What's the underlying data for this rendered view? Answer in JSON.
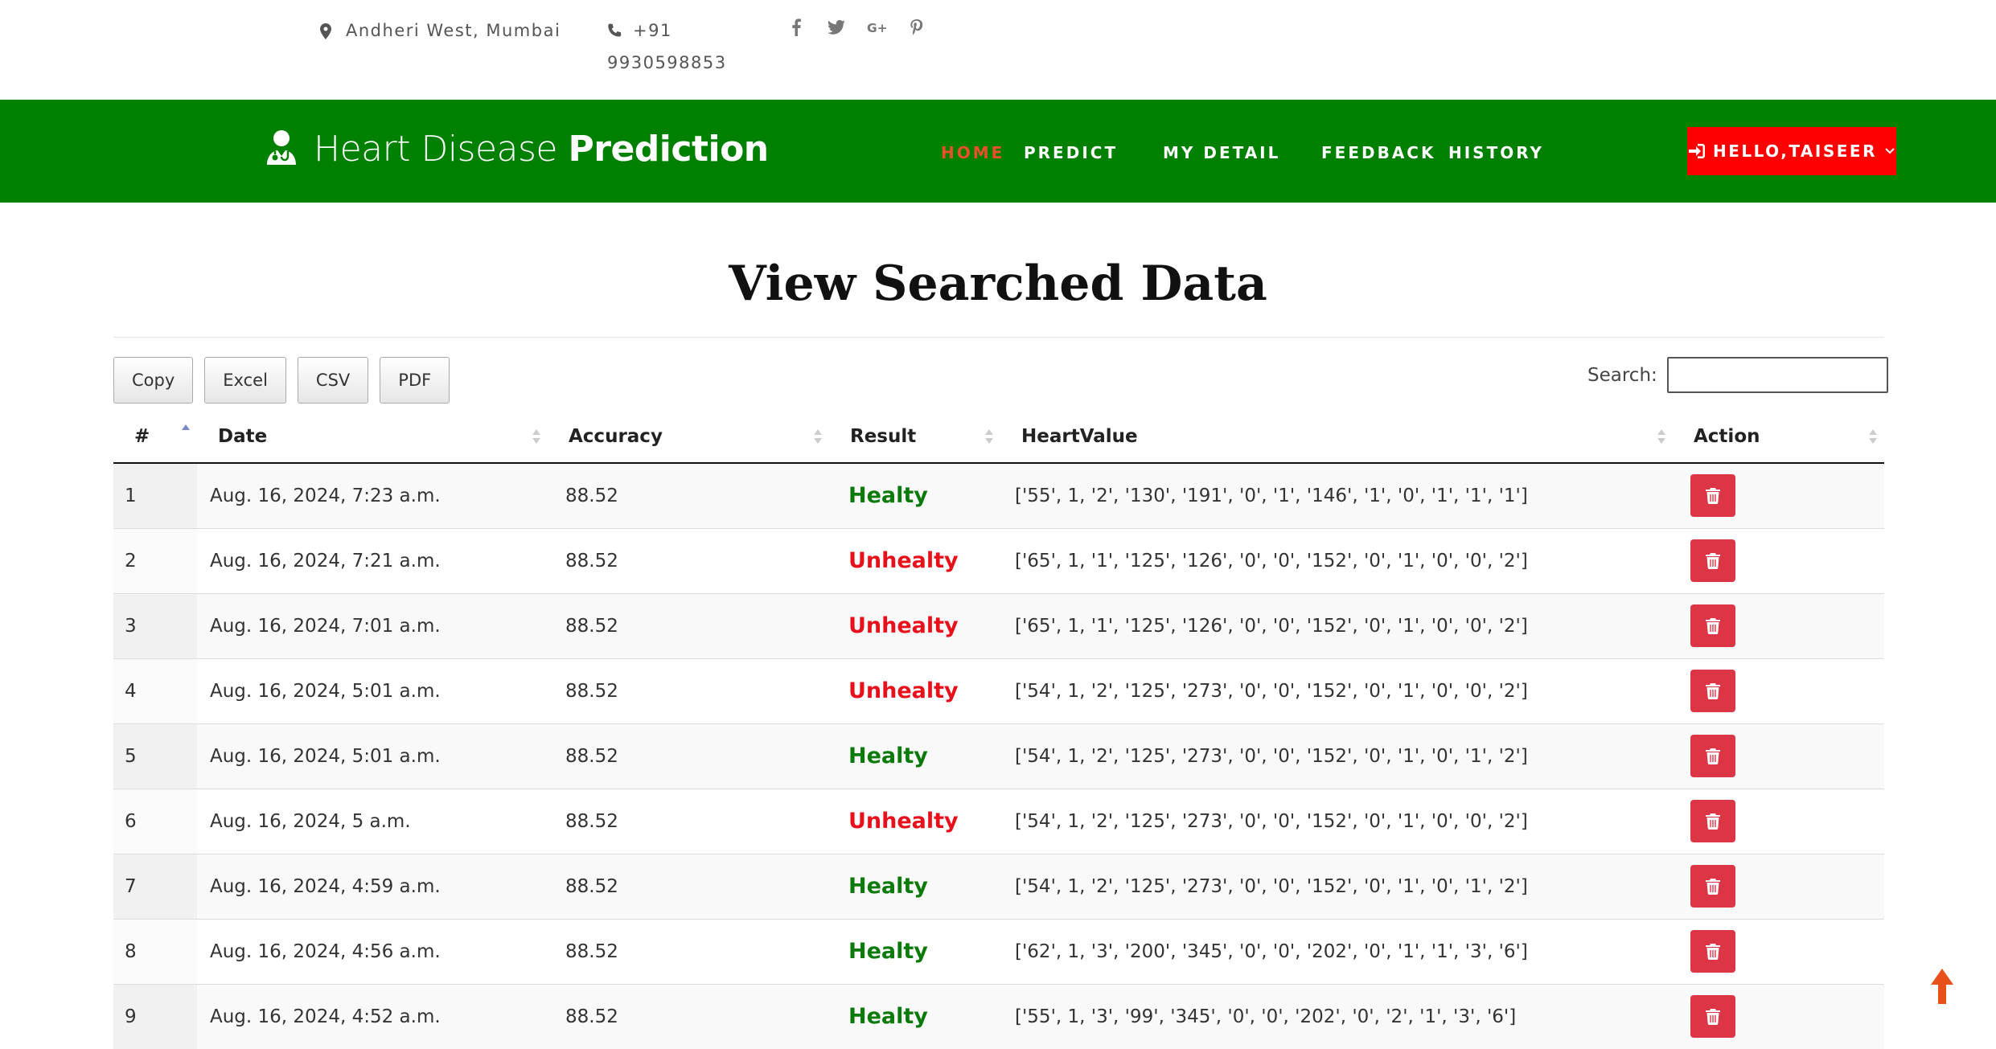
{
  "topbar": {
    "location": "Andheri West, Mumbai",
    "phone_line1": "+91",
    "phone_line2": "9930598853",
    "social": [
      "facebook-icon",
      "twitter-icon",
      "google-plus-icon",
      "pinterest-icon"
    ]
  },
  "navbar": {
    "brand_light": "Heart Disease ",
    "brand_bold": "Prediction",
    "links": [
      "HOME",
      "PREDICT",
      "MY DETAIL",
      "FEEDBACK",
      "HISTORY"
    ],
    "active_link": "HOME",
    "user_button": "HELLO,TAISEER",
    "colors": {
      "navbar": "#008000",
      "active": "#e8502a",
      "user_button": "#ff0000"
    }
  },
  "main": {
    "title": "View Searched Data",
    "buttons": [
      "Copy",
      "Excel",
      "CSV",
      "PDF"
    ],
    "search_label": "Search:",
    "search_value": ""
  },
  "table": {
    "columns": [
      "#",
      "Date",
      "Accuracy",
      "Result",
      "HeartValue",
      "Action"
    ],
    "rows": [
      {
        "no": "1",
        "date": "Aug. 16, 2024, 7:23 a.m.",
        "accuracy": "88.52",
        "result": "Healty",
        "heart": "['55', 1, '2', '130', '191', '0', '1', '146', '1', '0', '1', '1', '1']"
      },
      {
        "no": "2",
        "date": "Aug. 16, 2024, 7:21 a.m.",
        "accuracy": "88.52",
        "result": "Unhealty",
        "heart": "['65', 1, '1', '125', '126', '0', '0', '152', '0', '1', '0', '0', '2']"
      },
      {
        "no": "3",
        "date": "Aug. 16, 2024, 7:01 a.m.",
        "accuracy": "88.52",
        "result": "Unhealty",
        "heart": "['65', 1, '1', '125', '126', '0', '0', '152', '0', '1', '0', '0', '2']"
      },
      {
        "no": "4",
        "date": "Aug. 16, 2024, 5:01 a.m.",
        "accuracy": "88.52",
        "result": "Unhealty",
        "heart": "['54', 1, '2', '125', '273', '0', '0', '152', '0', '1', '0', '0', '2']"
      },
      {
        "no": "5",
        "date": "Aug. 16, 2024, 5:01 a.m.",
        "accuracy": "88.52",
        "result": "Healty",
        "heart": "['54', 1, '2', '125', '273', '0', '0', '152', '0', '1', '0', '1', '2']"
      },
      {
        "no": "6",
        "date": "Aug. 16, 2024, 5 a.m.",
        "accuracy": "88.52",
        "result": "Unhealty",
        "heart": "['54', 1, '2', '125', '273', '0', '0', '152', '0', '1', '0', '0', '2']"
      },
      {
        "no": "7",
        "date": "Aug. 16, 2024, 4:59 a.m.",
        "accuracy": "88.52",
        "result": "Healty",
        "heart": "['54', 1, '2', '125', '273', '0', '0', '152', '0', '1', '0', '1', '2']"
      },
      {
        "no": "8",
        "date": "Aug. 16, 2024, 4:56 a.m.",
        "accuracy": "88.52",
        "result": "Healty",
        "heart": "['62', 1, '3', '200', '345', '0', '0', '202', '0', '1', '1', '3', '6']"
      },
      {
        "no": "9",
        "date": "Aug. 16, 2024, 4:52 a.m.",
        "accuracy": "88.52",
        "result": "Healty",
        "heart": "['55', 1, '3', '99', '345', '0', '0', '202', '0', '2', '1', '3', '6']"
      }
    ],
    "row_action_icon": "trash-icon",
    "colors": {
      "healthy": "#0b7a0b",
      "unhealthy": "#e8101a",
      "delete_button": "#dc3545"
    }
  }
}
